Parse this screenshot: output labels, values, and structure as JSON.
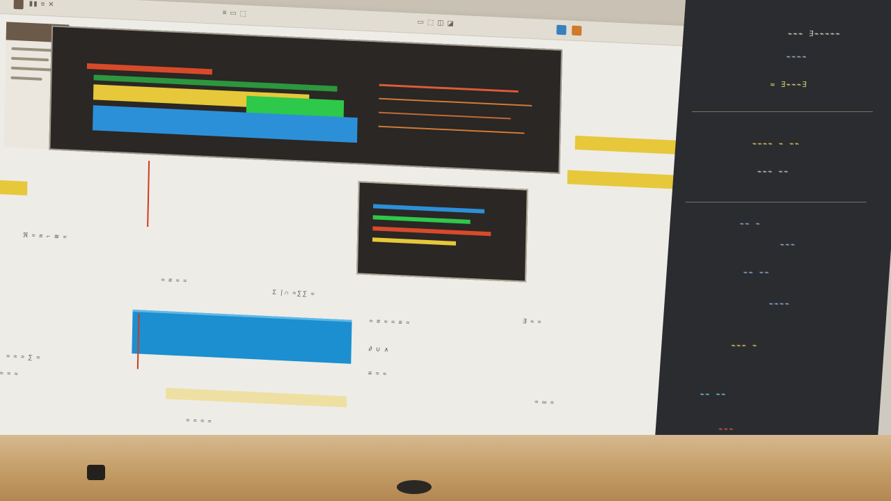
{
  "sheet": {
    "topbar_left": "▮▮ ≡ ✕",
    "topbar_mid": "≡ ▭ ⬚",
    "topbar_right": "▭ ⬚ ◫ ◪",
    "header_labels": [
      "≡≡ ≡≡ ≡",
      "▭ ≡ ▭ ≡",
      "⊞ ⊞"
    ]
  },
  "doc": {
    "rows": [
      {
        "text": "ℜ ≈ ≡ ⌐ ≋ ≈",
        "style": "small"
      },
      {
        "text": "≈ ≡ ≈ ≈",
        "style": "small"
      },
      {
        "text": "Σ ∣∩ ≈∑∑ ≈",
        "style": "small"
      },
      {
        "text": "≈ ≡ ≈ ≈ ≡ ≈",
        "style": "small"
      },
      {
        "text": "∃ ≈ ≈",
        "style": "small"
      },
      {
        "text": "∂ ∪ ∧",
        "style": "small"
      },
      {
        "text": "≡ ≈ ≈",
        "style": "small"
      },
      {
        "text": "≈ ∞ ≈",
        "style": "small"
      },
      {
        "text": "≈ ≈ ≈ ∑ ≈",
        "style": "small"
      },
      {
        "text": "∘ ≈ ≈ ≈",
        "style": "small"
      },
      {
        "text": "≈ ≈ ≈ ≈",
        "style": "small"
      }
    ]
  },
  "right_panel": {
    "rows": [
      {
        "text": "⌁⌁⌁ ∃⌁⌁⌁⌁⌁",
        "color": "#d9d2bb"
      },
      {
        "text": "⌁⌁⌁⌁",
        "color": "#9fb6c8"
      },
      {
        "text": "≈ ∃⌁⌁⌁∃",
        "color": "#e0d47a"
      },
      {
        "text": "⌁⌁⌁⌁ ⌁ ⌁⌁",
        "color": "#e6c85a"
      },
      {
        "text": "⌁⌁⌁ ⌁⌁",
        "color": "#cbc6b2"
      },
      {
        "text": "⌁⌁ ⌁",
        "color": "#8fb0d4"
      },
      {
        "text": "⌁⌁⌁",
        "color": "#8fb0d4"
      },
      {
        "text": "⌁⌁ ⌁⌁",
        "color": "#8fb0d4"
      },
      {
        "text": "⌁⌁⌁⌁",
        "color": "#8fb0d4"
      },
      {
        "text": "⌁⌁⌁ ⌁",
        "color": "#e6c85a"
      },
      {
        "text": "⌁⌁ ⌁⌁",
        "color": "#7ac2e8"
      },
      {
        "text": "⌁⌁⌁",
        "color": "#e25b3a"
      }
    ]
  },
  "colors": {
    "yellow": "#e6c83a",
    "blue": "#1b8fd0",
    "green": "#2ec84a",
    "red": "#d03a1f",
    "dark_panel": "#2a2724",
    "paper": "#eeece7"
  }
}
